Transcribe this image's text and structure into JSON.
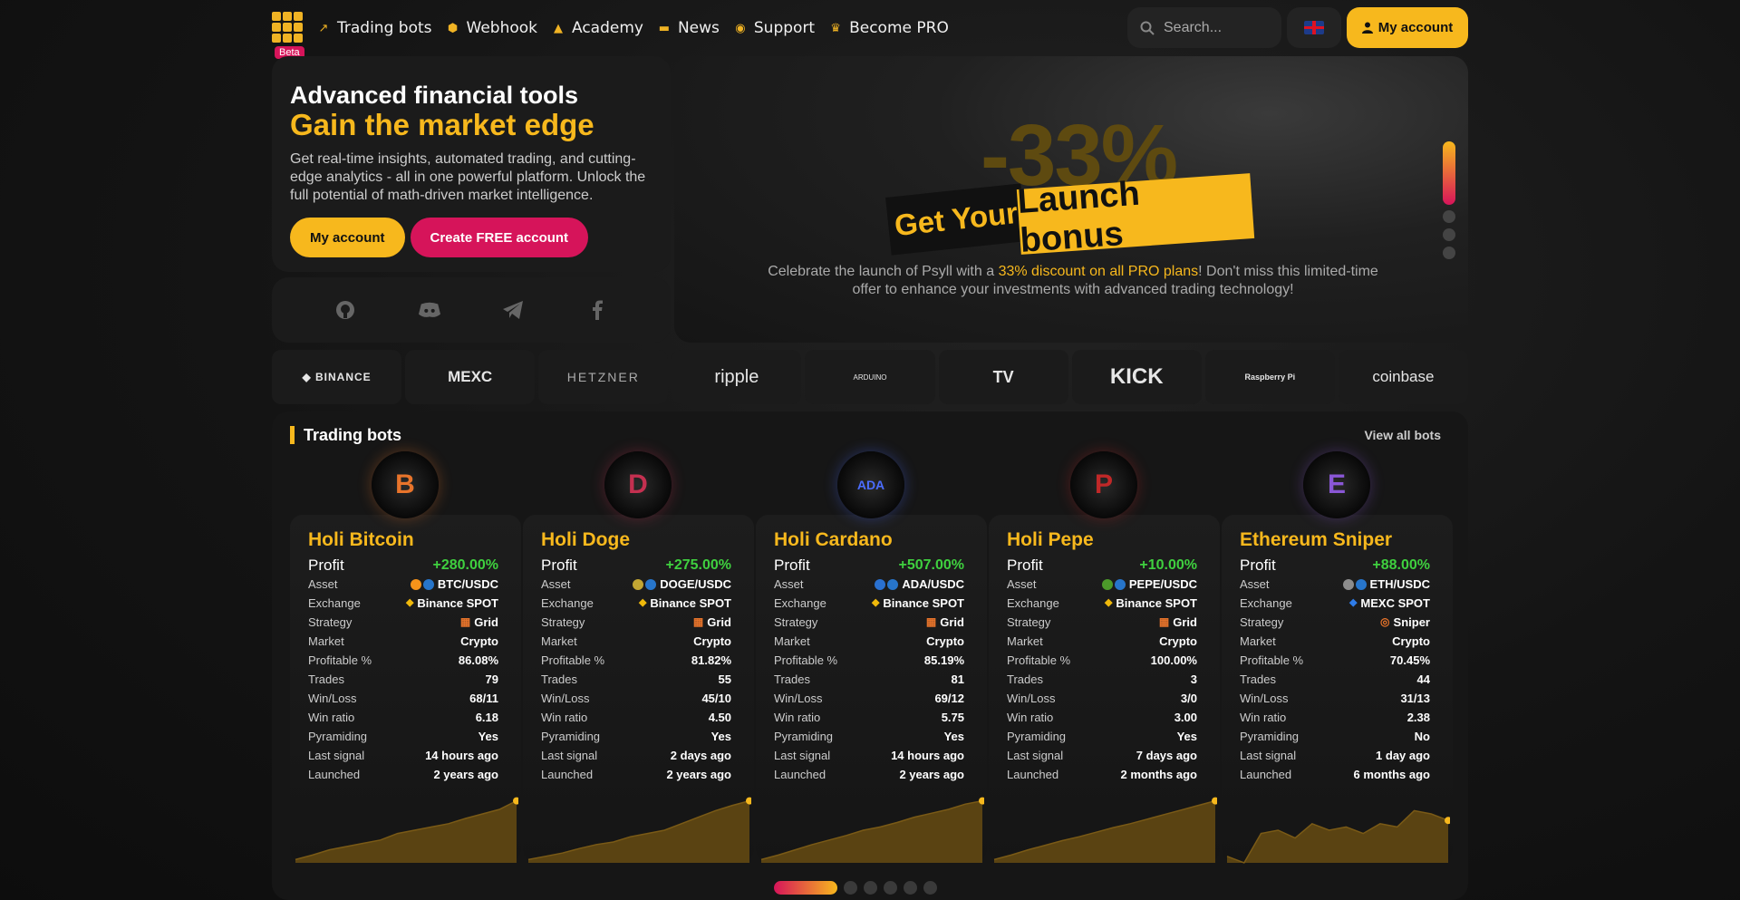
{
  "nav": {
    "beta": "Beta",
    "items": [
      {
        "label": "Trading bots",
        "icon": "chart-icon"
      },
      {
        "label": "Webhook",
        "icon": "webhook-icon"
      },
      {
        "label": "Academy",
        "icon": "graduation-icon"
      },
      {
        "label": "News",
        "icon": "newspaper-icon"
      },
      {
        "label": "Support",
        "icon": "support-icon"
      },
      {
        "label": "Become PRO",
        "icon": "crown-icon"
      }
    ],
    "search_placeholder": "Search...",
    "account_label": "My account"
  },
  "hero": {
    "title": "Advanced financial tools",
    "subtitle": "Gain the market edge",
    "description": "Get real-time insights, automated trading, and cutting-edge analytics - all in one powerful platform. Unlock the full potential of math-driven market intelligence.",
    "my_account": "My account",
    "create_account": "Create FREE account"
  },
  "socials": [
    "github-icon",
    "discord-icon",
    "telegram-icon",
    "facebook-icon"
  ],
  "promo": {
    "percent": "-33%",
    "get_your": "Get Your",
    "launch_bonus": "Launch bonus",
    "text_before": "Celebrate the launch of Psyll with a ",
    "highlight": "33% discount on all PRO plans",
    "text_after": "! Don't miss this limited-time offer to enhance your investments with advanced trading technology!"
  },
  "partners": [
    "BINANCE",
    "MEXC",
    "HETZNER",
    "ripple",
    "ARDUINO",
    "TV",
    "KICK",
    "Raspberry Pi",
    "coinbase"
  ],
  "bots_section": {
    "title": "Trading bots",
    "view_all": "View all bots",
    "labels": {
      "profit": "Profit",
      "asset": "Asset",
      "exchange": "Exchange",
      "strategy": "Strategy",
      "market": "Market",
      "profitable": "Profitable %",
      "trades": "Trades",
      "winloss": "Win/Loss",
      "winratio": "Win ratio",
      "pyramiding": "Pyramiding",
      "last_signal": "Last signal",
      "launched": "Launched"
    },
    "bots": [
      {
        "name": "Holi Bitcoin",
        "avatar": "B",
        "profit": "+280.00%",
        "asset": "BTC/USDC",
        "exchange": "Binance SPOT",
        "strategy": "Grid",
        "market": "Crypto",
        "profitable": "86.08%",
        "trades": "79",
        "winloss": "68/11",
        "winratio": "6.18",
        "pyramiding": "Yes",
        "last_signal": "14 hours ago",
        "launched": "2 years ago",
        "spark": [
          0.05,
          0.12,
          0.2,
          0.25,
          0.3,
          0.35,
          0.45,
          0.5,
          0.55,
          0.6,
          0.68,
          0.75,
          0.82,
          0.95
        ]
      },
      {
        "name": "Holi Doge",
        "avatar": "D",
        "profit": "+275.00%",
        "asset": "DOGE/USDC",
        "exchange": "Binance SPOT",
        "strategy": "Grid",
        "market": "Crypto",
        "profitable": "81.82%",
        "trades": "55",
        "winloss": "45/10",
        "winratio": "4.50",
        "pyramiding": "Yes",
        "last_signal": "2 days ago",
        "launched": "2 years ago",
        "spark": [
          0.05,
          0.1,
          0.15,
          0.22,
          0.28,
          0.32,
          0.4,
          0.45,
          0.5,
          0.6,
          0.7,
          0.8,
          0.88,
          0.95
        ]
      },
      {
        "name": "Holi Cardano",
        "avatar": "ADA",
        "profit": "+507.00%",
        "asset": "ADA/USDC",
        "exchange": "Binance SPOT",
        "strategy": "Grid",
        "market": "Crypto",
        "profitable": "85.19%",
        "trades": "81",
        "winloss": "69/12",
        "winratio": "5.75",
        "pyramiding": "Yes",
        "last_signal": "14 hours ago",
        "launched": "2 years ago",
        "spark": [
          0.05,
          0.12,
          0.2,
          0.28,
          0.35,
          0.42,
          0.5,
          0.55,
          0.62,
          0.7,
          0.76,
          0.82,
          0.9,
          0.95
        ]
      },
      {
        "name": "Holi Pepe",
        "avatar": "P",
        "profit": "+10.00%",
        "asset": "PEPE/USDC",
        "exchange": "Binance SPOT",
        "strategy": "Grid",
        "market": "Crypto",
        "profitable": "100.00%",
        "trades": "3",
        "winloss": "3/0",
        "winratio": "3.00",
        "pyramiding": "Yes",
        "last_signal": "7 days ago",
        "launched": "2 months ago",
        "spark": [
          0.05,
          0.12,
          0.2,
          0.27,
          0.34,
          0.4,
          0.47,
          0.54,
          0.6,
          0.67,
          0.74,
          0.81,
          0.88,
          0.95
        ]
      },
      {
        "name": "Ethereum Sniper",
        "avatar": "E",
        "profit": "+88.00%",
        "asset": "ETH/USDC",
        "exchange": "MEXC SPOT",
        "strategy": "Sniper",
        "market": "Crypto",
        "profitable": "70.45%",
        "trades": "44",
        "winloss": "31/13",
        "winratio": "2.38",
        "pyramiding": "No",
        "last_signal": "1 day ago",
        "launched": "6 months ago",
        "spark": [
          0.1,
          0.0,
          0.45,
          0.5,
          0.38,
          0.6,
          0.5,
          0.55,
          0.45,
          0.6,
          0.55,
          0.8,
          0.75,
          0.65
        ]
      }
    ]
  },
  "colors": {
    "accent": "#f7b81d",
    "pink": "#d6145a",
    "profit": "#3fd03f"
  }
}
